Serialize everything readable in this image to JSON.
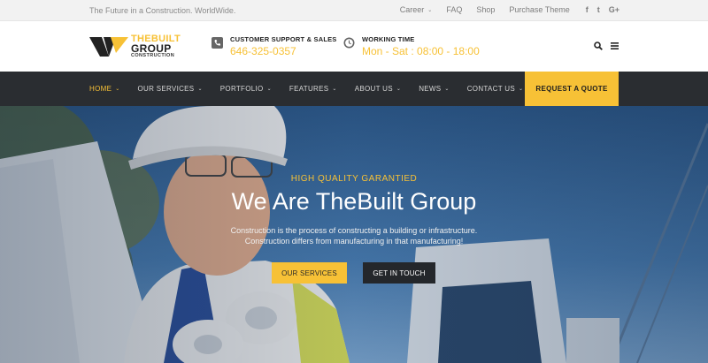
{
  "topbar": {
    "tagline": "The Future in a Construction. WorldWide.",
    "links": [
      "Career",
      "FAQ",
      "Shop",
      "Purchase Theme"
    ],
    "social": [
      "f",
      "t",
      "G+"
    ]
  },
  "header": {
    "logo": {
      "line1": "THEBUILT",
      "line2": "GROUP",
      "line3": "CONSTRUCTION"
    },
    "support": {
      "label": "CUSTOMER SUPPORT & SALES",
      "value": "646-325-0357"
    },
    "hours": {
      "label": "WORKING TIME",
      "value": "Mon - Sat : 08:00 - 18:00"
    }
  },
  "nav": {
    "items": [
      "HOME",
      "OUR SERVICES",
      "PORTFOLIO",
      "FEATURES",
      "ABOUT US",
      "NEWS",
      "CONTACT US"
    ],
    "cta": "REQUEST A QUOTE"
  },
  "hero": {
    "kicker": "HIGH QUALITY GARANTIED",
    "headline": "We Are TheBuilt Group",
    "desc_line1": "Construction is the process of constructing a building or infrastructure.",
    "desc_line2": "Construction differs from manufacturing in that manufacturing!",
    "primary_button": "OUR SERVICES",
    "secondary_button": "GET IN TOUCH"
  },
  "colors": {
    "accent": "#f7c136",
    "nav_bg": "#2a2d31",
    "dark": "#222222"
  },
  "icons": [
    "phone-icon",
    "clock-icon",
    "search-icon",
    "hamburger-menu-icon"
  ]
}
